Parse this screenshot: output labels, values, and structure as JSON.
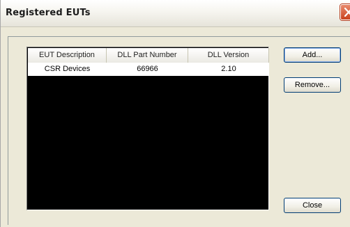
{
  "window": {
    "title": "Registered EUTs"
  },
  "table": {
    "columns": [
      "EUT Description",
      "DLL Part Number",
      "DLL Version"
    ],
    "rows": [
      [
        "CSR Devices",
        "66966",
        "2.10"
      ]
    ]
  },
  "buttons": {
    "add": "Add...",
    "remove": "Remove...",
    "close": "Close"
  },
  "icons": {
    "close": "close-icon"
  },
  "colors": {
    "list_background": "#000000",
    "close_button": "#d2542c",
    "button_border": "#003c74"
  }
}
